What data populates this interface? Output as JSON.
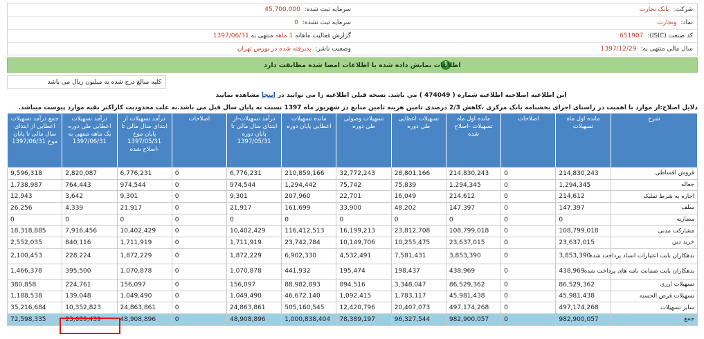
{
  "info": {
    "company_label": "شرکت:",
    "company": "بانک تجارت",
    "symbol_label": "نماد:",
    "symbol": "وتجارت",
    "isic_label": "کد صنعت (ISIC):",
    "isic": "651907",
    "fiscal_label": "سال مالی منتهی به:",
    "fiscal": "1397/12/29",
    "capital_label": "سرمایه ثبت شده:",
    "capital": "45,700,000",
    "unreg_capital_label": "سرمایه ثبت نشده:",
    "unreg_capital": "0",
    "report_label": "گزارش فعالیت ماهانه",
    "report_period": "1 ماهه",
    "report_end_label": "منتهی به",
    "report_end": "1397/06/31",
    "status_label": "وضعیت ناشر:",
    "status": "پذیرفته شده در بورس تهران"
  },
  "banner": {
    "text": "اطلاعات نمایش داده شده با اطلاعات امضا شده مطابقت دارد",
    "icon": "info-icon"
  },
  "unit_note": "کلیه مبالغ درج شده به میلیون ریال می باشد",
  "notice": {
    "prefix": "این اطلاعیه اصلاحیه اطلاعیه شماره ( 474049 ) می باشد. نسخه قبلی اطلاعیه را می توانید در",
    "link": "اینجا",
    "suffix": "مشاهده نمایید"
  },
  "reason": "دلایل اصلاح:ار موارد با اهمیت در راستای اجرای بخشنامه بانک مرکزی ،کاهش 2/3 درصدی تامین هزینه تامین منابع در شهریور ماه 1397 نسبت به پایان سال قبل می باشد.به علت محدودیت کاراکتر بقیه موارد پیوست میباشد.",
  "table": {
    "headers": [
      "شرح",
      "مانده اول ماه تسهیلات",
      "اصلاحات",
      "مانده اول ماه تسهیلات -اصلاح شده",
      "تسهیلات اعطایی طی دوره",
      "تسهیلات وصولی طی دوره",
      "مانده تسهیلات اعطایی پایان دوره",
      "درآمد تسهیلات-از ابتدای سال مالی تا پایان دوره 1397/05/31",
      "اصلاحات",
      "درآمد تسهیلات از ابتدای سال مالی تا پایان موخ 1397/05/31 -اصلاح شده",
      "درآمد تسهیلات اعطایی طی دوره یک ماهه منتهی به 1397/06/31",
      "جمع درآمد تسهیلات اعطایی از ابتدای سال مالی تا پایان موخ 1397/06/31"
    ],
    "rows": [
      [
        "فروش اقساطی",
        "214,830,243",
        "0",
        "214,830,243",
        "28,801,166",
        "32,772,243",
        "210,859,166",
        "6,776,231",
        "0",
        "6,776,231",
        "2,820,087",
        "9,596,318"
      ],
      [
        "جعاله",
        "1,294,345",
        "0",
        "1,294,345",
        "75,839",
        "75,742",
        "1,294,442",
        "974,544",
        "0",
        "974,544",
        "764,443",
        "1,738,987"
      ],
      [
        "اجاره به شرط تملیک",
        "214,612",
        "0",
        "214,612",
        "16,049",
        "22,701",
        "207,960",
        "9,301",
        "0",
        "9,301",
        "3,642",
        "12,943"
      ],
      [
        "سلف",
        "147,397",
        "0",
        "147,397",
        "48,202",
        "33,900",
        "161,699",
        "21,917",
        "0",
        "21,917",
        "4,339",
        "26,256"
      ],
      [
        "مضاربه",
        "0",
        "0",
        "0",
        "0",
        "0",
        "0",
        "0",
        "0",
        "0",
        "0",
        "0"
      ],
      [
        "مشارکت مدنی",
        "108,799,018",
        "0",
        "108,799,018",
        "23,812,708",
        "16,199,213",
        "116,412,513",
        "10,402,429",
        "0",
        "10,402,429",
        "7,916,456",
        "18,318,885"
      ],
      [
        "خرید دین",
        "23,637,015",
        "0",
        "23,637,015",
        "10,255,475",
        "10,149,706",
        "23,742,784",
        "1,711,919",
        "0",
        "1,711,919",
        "840,116",
        "2,552,035"
      ],
      [
        "بدهکاران بابت اعتبارات اسناد پرداخت شده",
        "3,853,390",
        "0",
        "3,853,390",
        "7,581,431",
        "4,532,491",
        "6,902,330",
        "1,872,229",
        "0",
        "1,872,229",
        "228,224",
        "2,100,453"
      ],
      [
        "بدهکاران بابت ضمانت نامه های پرداخت شده",
        "438,969",
        "0",
        "438,969",
        "198,437",
        "195,474",
        "441,932",
        "1,070,878",
        "0",
        "1,070,878",
        "395,500",
        "1,466,378"
      ],
      [
        "تسهیلات ارزی",
        "86,529,362",
        "0",
        "86,529,362",
        "3,348,047",
        "894,516",
        "88,982,893",
        "156,097",
        "0",
        "156,097",
        "224,761",
        "380,858"
      ],
      [
        "تسهیلات قرض الحسنه",
        "45,981,438",
        "0",
        "45,981,438",
        "1,783,117",
        "1,092,415",
        "46,672,140",
        "1,049,490",
        "0",
        "1,049,490",
        "139,048",
        "1,188,538"
      ],
      [
        "سایر تسهیلات",
        "497,174,268",
        "0",
        "497,174,268",
        "20,407,073",
        "12,420,796",
        "505,160,545",
        "24,863,861",
        "0",
        "24,863,861",
        "10,352,823",
        "35,216,684"
      ]
    ],
    "total": [
      "جمع",
      "982,900,057",
      "0",
      "982,900,057",
      "96,327,544",
      "78,389,197",
      "1,000,838,404",
      "48,908,896",
      "0",
      "48,908,896",
      "23,689,439",
      "72,598,335"
    ]
  },
  "colors": {
    "header_bg": "#4a86c5",
    "banner_bg": "#a5d48e",
    "total_bg": "#9ccfe3",
    "highlight": "#e01515"
  }
}
